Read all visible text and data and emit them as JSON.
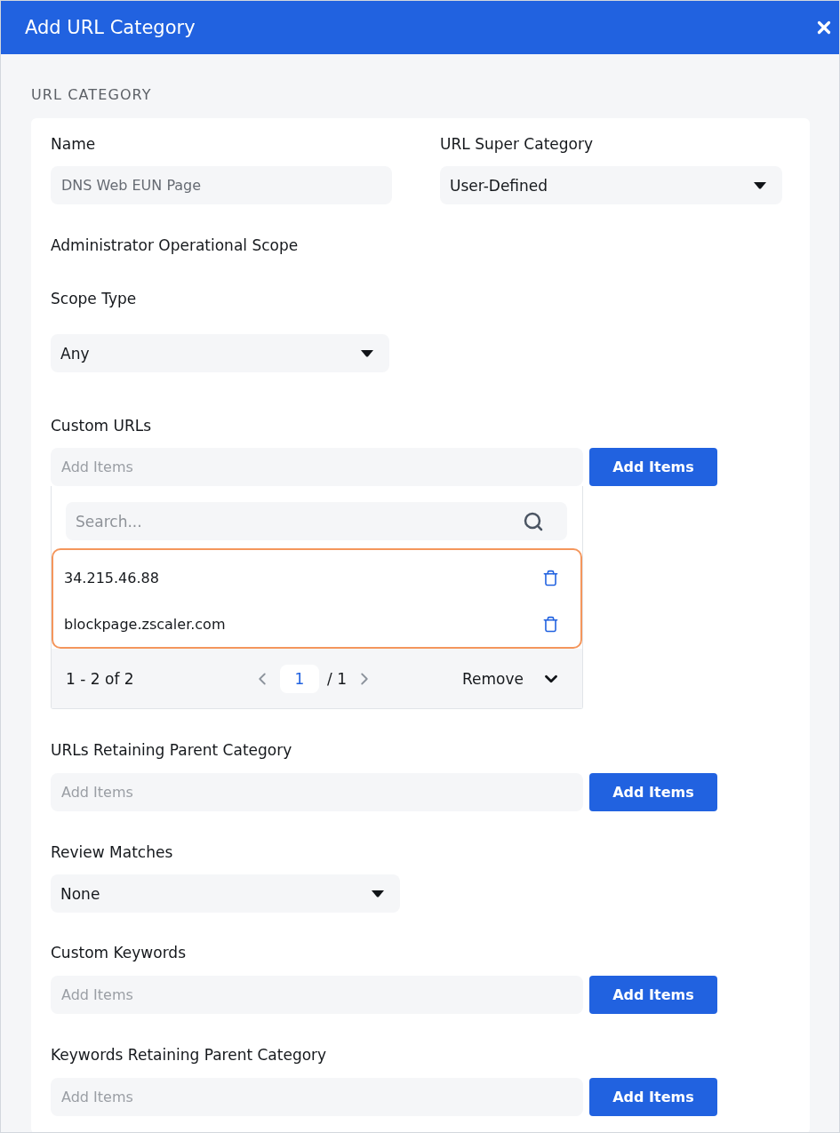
{
  "dialog": {
    "title": "Add URL Category"
  },
  "section_title": "URL CATEGORY",
  "name": {
    "label": "Name",
    "value": "DNS Web EUN Page",
    "disabled": true
  },
  "super_category": {
    "label": "URL Super Category",
    "value": "User-Defined"
  },
  "scope": {
    "heading": "Administrator Operational Scope",
    "label": "Scope Type",
    "value": "Any"
  },
  "custom_urls": {
    "label": "Custom URLs",
    "placeholder": "Add Items",
    "button": "Add Items",
    "dropdown": {
      "search": {
        "placeholder": "Search..."
      },
      "highlighted": true,
      "items": [
        "34.215.46.88",
        "blockpage.zscaler.com"
      ],
      "summary": "1 - 2 of 2",
      "page": "1",
      "page_total": "/ 1",
      "action": "Remove"
    }
  },
  "fields": [
    {
      "kind": "items",
      "label": "URLs Retaining Parent Category",
      "placeholder": "Add Items",
      "button": "Add Items"
    },
    {
      "kind": "select",
      "label": "Review Matches",
      "value": "None"
    },
    {
      "kind": "items",
      "label": "Custom Keywords",
      "placeholder": "Add Items",
      "button": "Add Items"
    },
    {
      "kind": "items",
      "label": "Keywords Retaining Parent Category",
      "placeholder": "Add Items",
      "button": "Add Items"
    }
  ]
}
